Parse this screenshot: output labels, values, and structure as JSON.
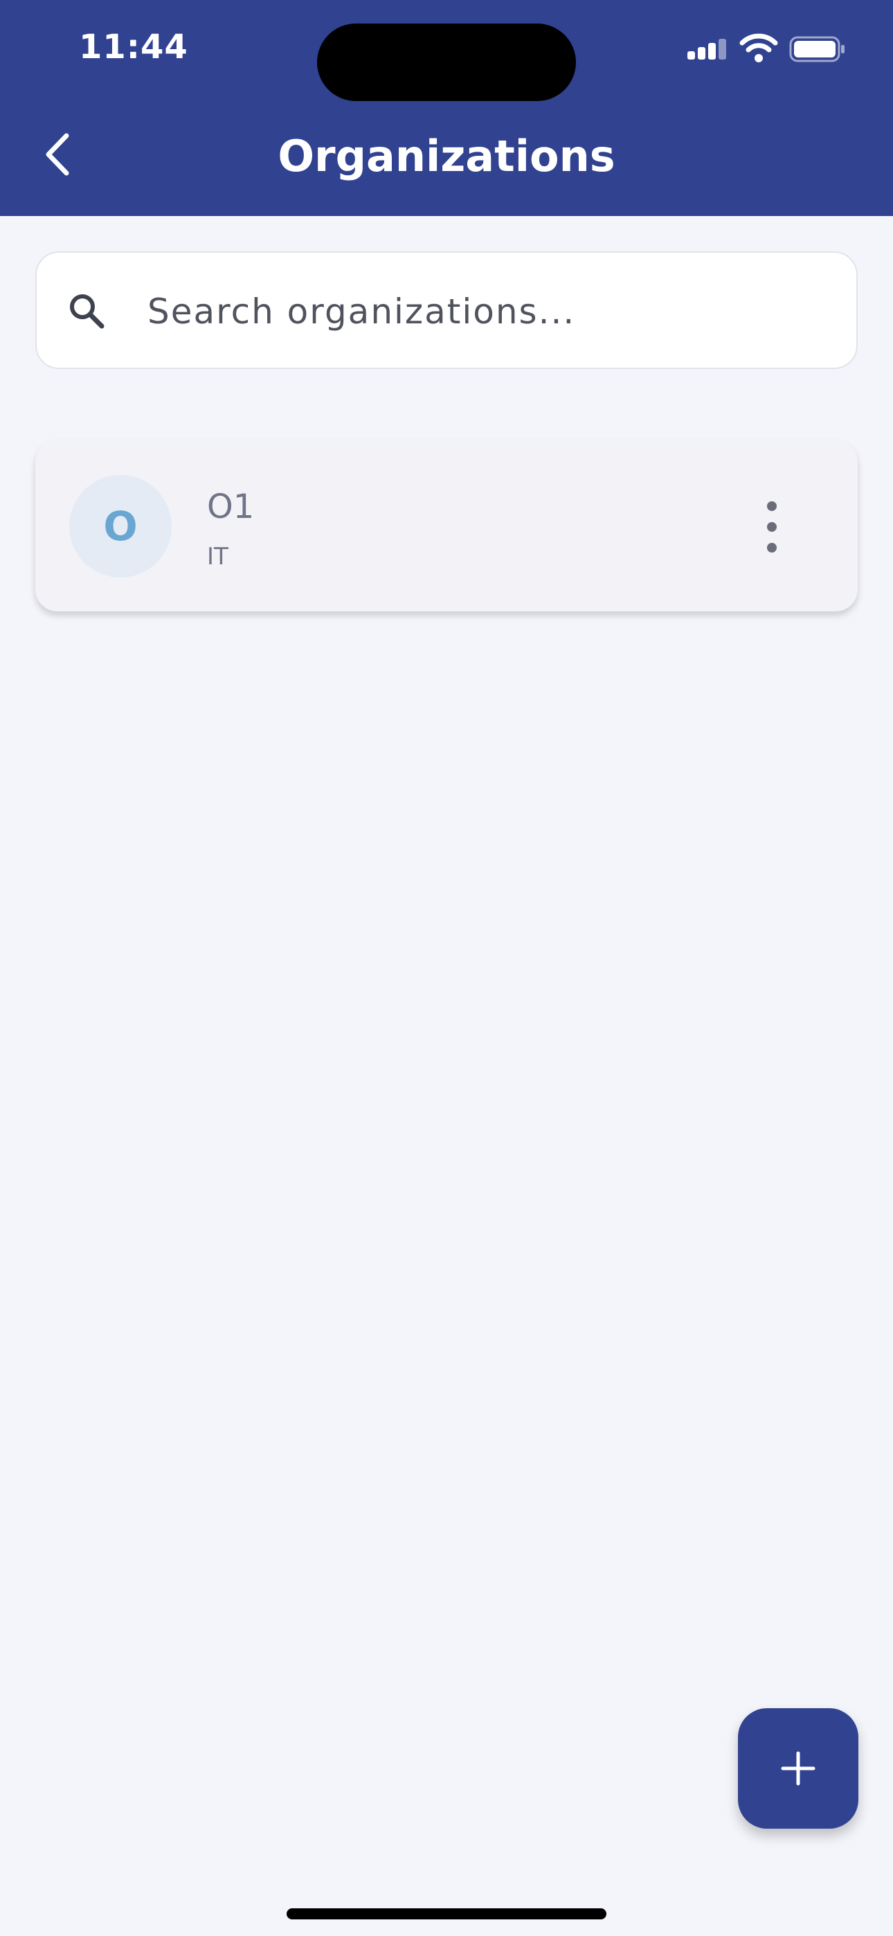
{
  "status_bar": {
    "time": "11:44",
    "signal_icon": "cellular-signal-icon",
    "wifi_icon": "wifi-icon",
    "battery_icon": "battery-icon"
  },
  "header": {
    "title": "Organizations",
    "back_icon": "chevron-left-icon",
    "background_color": "#304290"
  },
  "search": {
    "placeholder": "Search organizations...",
    "value": "",
    "icon": "search-icon"
  },
  "organizations": [
    {
      "initial": "O",
      "name": "O1",
      "type": "IT",
      "menu_icon": "more-vertical-icon"
    }
  ],
  "fab": {
    "icon": "plus-icon",
    "color": "#304290"
  },
  "colors": {
    "background": "#f4f5fa",
    "avatar_background": "#e4ebf4",
    "avatar_letter": "#6aa6d2"
  }
}
